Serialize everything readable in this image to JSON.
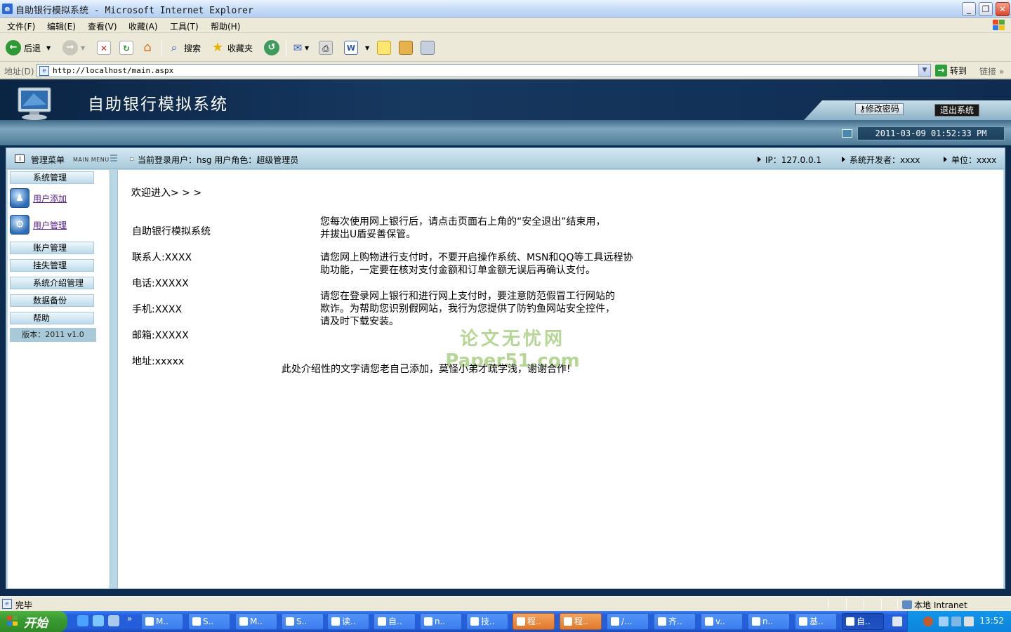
{
  "window": {
    "title": "自助银行模拟系统 - Microsoft Internet Explorer",
    "buttons": {
      "min": "_",
      "max": "❐",
      "close": "✕"
    }
  },
  "menubar": [
    "文件(F)",
    "编辑(E)",
    "查看(V)",
    "收藏(A)",
    "工具(T)",
    "帮助(H)"
  ],
  "toolbar": {
    "back_label": "后退",
    "search_label": "搜索",
    "favorites_label": "收藏夹"
  },
  "addressbar": {
    "label": "地址(D)",
    "url": "http://localhost/main.aspx",
    "go_label": "转到",
    "links_label": "链接"
  },
  "app": {
    "system_title": "自助银行模拟系统",
    "change_password": "修改密码",
    "logout": "退出系统",
    "datetime": "2011-03-09 01:52:33 PM"
  },
  "header": {
    "menu_title": "管理菜单",
    "menu_en": "MAIN MENU",
    "user_info": "当前登录用户：hsg  用户角色：超级管理员",
    "ip": "IP：127.0.0.1",
    "developer": "系统开发者：xxxx",
    "unit": "单位：xxxx"
  },
  "sidebar": {
    "system_mgmt": "系统管理",
    "user_add": "用户添加",
    "user_mgmt": "用户管理",
    "account_mgmt": "账户管理",
    "loss_mgmt": "挂失管理",
    "intro_mgmt": "系统介绍管理",
    "backup": "数据备份",
    "help": "帮助",
    "version": "版本：2011 v1.0"
  },
  "content": {
    "welcome": "欢迎进入> > >",
    "sys_name": "自助银行模拟系统",
    "contact": "联系人:XXXX",
    "phone": "电话:XXXXX",
    "mobile": "手机:XXXX",
    "email": "邮箱:XXXXX",
    "address": "地址:xxxxx",
    "tip1_l1": "您每次使用网上银行后，请点击页面右上角的“安全退出”结束用，",
    "tip1_l2": "并拔出U盾妥善保管。",
    "tip2_l1": "请您网上购物进行支付时，不要开启操作系统、MSN和QQ等工具远程协",
    "tip2_l2": "助功能，一定要在核对支付金额和订单金额无误后再确认支付。",
    "tip3_l1": "请您在登录网上银行和进行网上支付时，要注意防范假冒工行网站的",
    "tip3_l2": "欺诈。为帮助您识别假网站，我行为您提供了防钓鱼网站安全控件，",
    "tip3_l3": "请及时下载安装。",
    "footer_note": "此处介绍性的文字请您老自己添加，莫怪小弟才疏学浅，谢谢合作!",
    "watermark_1": "论文无忧网",
    "watermark_2": "Paper51.com"
  },
  "statusbar": {
    "status": "完毕",
    "zone": "本地 Intranet"
  },
  "taskbar": {
    "start": "开始",
    "tasks": [
      "M..",
      "S..",
      "M..",
      "S..",
      "读..",
      "自..",
      "n..",
      "技..",
      "程..",
      "程..",
      "/...",
      "齐..",
      "v..",
      "n..",
      "基..",
      "自.."
    ],
    "clock": "13:52"
  }
}
